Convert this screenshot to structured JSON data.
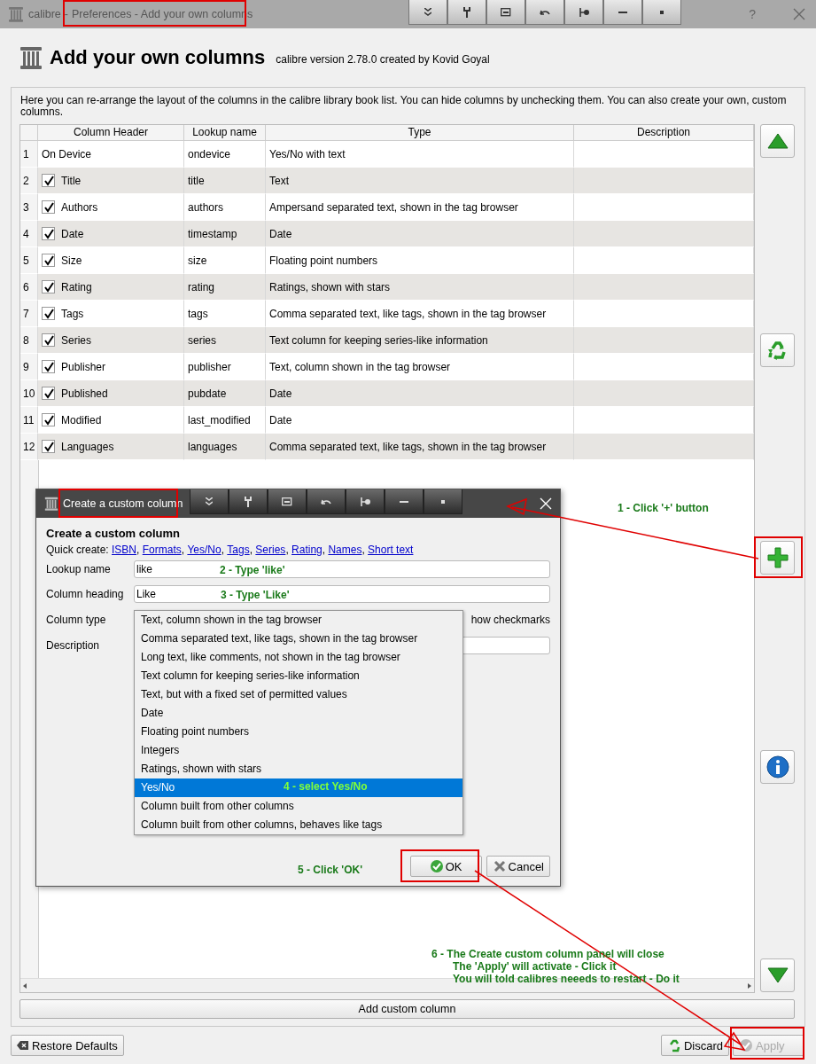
{
  "window": {
    "app": "calibre",
    "separator": "-",
    "title": "Preferences - Add your own columns",
    "help": "?"
  },
  "header": {
    "title": "Add your own columns",
    "subtitle": "calibre version 2.78.0 created by Kovid Goyal"
  },
  "intro": "Here you can re-arrange the layout of the columns in the calibre library book list. You can hide columns by unchecking them. You can also create your own, custom columns.",
  "table": {
    "columns": [
      "Column Header",
      "Lookup name",
      "Type",
      "Description"
    ],
    "rows": [
      {
        "number": "1",
        "kind": "plain",
        "header": "On Device",
        "lookup": "ondevice",
        "type": "Yes/No with text"
      },
      {
        "number": "2",
        "kind": "checkbox",
        "checked": true,
        "header": "Title",
        "lookup": "title",
        "type": "Text"
      },
      {
        "number": "3",
        "kind": "checkbox",
        "checked": true,
        "header": "Authors",
        "lookup": "authors",
        "type": "Ampersand separated text, shown in the tag browser"
      },
      {
        "number": "4",
        "kind": "checkbox",
        "checked": true,
        "header": "Date",
        "lookup": "timestamp",
        "type": "Date"
      },
      {
        "number": "5",
        "kind": "checkbox",
        "checked": true,
        "header": "Size",
        "lookup": "size",
        "type": "Floating point numbers"
      },
      {
        "number": "6",
        "kind": "checkbox",
        "checked": true,
        "header": "Rating",
        "lookup": "rating",
        "type": "Ratings, shown with stars"
      },
      {
        "number": "7",
        "kind": "checkbox",
        "checked": true,
        "header": "Tags",
        "lookup": "tags",
        "type": "Comma separated text, like tags, shown in the tag browser"
      },
      {
        "number": "8",
        "kind": "checkbox",
        "checked": true,
        "header": "Series",
        "lookup": "series",
        "type": "Text column for keeping series-like information"
      },
      {
        "number": "9",
        "kind": "checkbox",
        "checked": true,
        "header": "Publisher",
        "lookup": "publisher",
        "type": "Text, column shown in the tag browser"
      },
      {
        "number": "10",
        "kind": "checkbox",
        "checked": true,
        "header": "Published",
        "lookup": "pubdate",
        "type": "Date"
      },
      {
        "number": "11",
        "kind": "checkbox",
        "checked": true,
        "header": "Modified",
        "lookup": "last_modified",
        "type": "Date"
      },
      {
        "number": "12",
        "kind": "checkbox",
        "checked": true,
        "header": "Languages",
        "lookup": "languages",
        "type": "Comma separated text, like tags, shown in the tag browser"
      }
    ]
  },
  "add_button": "Add custom column",
  "footer": {
    "restore": "Restore Defaults",
    "discard": "Discard",
    "apply": {
      "label": "Apply",
      "disabled": true
    }
  },
  "dialog": {
    "title": "Create a custom column",
    "heading": "Create a custom column",
    "quick_label": "Quick create:",
    "quick_links": [
      "ISBN",
      "Formats",
      "Yes/No",
      "Tags",
      "Series",
      "Rating",
      "Names",
      "Short text"
    ],
    "link_separator": ",",
    "fields": [
      {
        "label": "Lookup name",
        "value": "like"
      },
      {
        "label": "Column heading",
        "value": "Like"
      }
    ],
    "type_label": "Column type",
    "description_label": "Description",
    "checkmarks": "how checkmarks",
    "type_options": [
      {
        "label": "Text, column shown in the tag browser",
        "selected": false
      },
      {
        "label": "Comma separated text, like tags, shown in the tag browser",
        "selected": false
      },
      {
        "label": "Long text, like comments, not shown in the tag browser",
        "selected": false
      },
      {
        "label": "Text column for keeping series-like information",
        "selected": false
      },
      {
        "label": "Text, but with a fixed set of permitted values",
        "selected": false
      },
      {
        "label": "Date",
        "selected": false
      },
      {
        "label": "Floating point numbers",
        "selected": false
      },
      {
        "label": "Integers",
        "selected": false
      },
      {
        "label": "Ratings, shown with stars",
        "selected": false
      },
      {
        "label": "Yes/No",
        "selected": true
      },
      {
        "label": "Column built from other columns",
        "selected": false
      },
      {
        "label": "Column built from other columns, behaves like tags",
        "selected": false
      }
    ],
    "ok": "OK",
    "cancel": "Cancel"
  },
  "annotations": [
    {
      "lines": [
        "1 - Click '+' button"
      ]
    },
    {
      "lines": [
        "2 - Type 'like'"
      ]
    },
    {
      "lines": [
        "3 - Type 'Like'"
      ]
    },
    {
      "lines": [
        "4 - select Yes/No"
      ]
    },
    {
      "lines": [
        "5 - Click 'OK'"
      ]
    },
    {
      "lines": [
        "6 - The Create custom column panel will close",
        "The 'Apply' will activate - Click it",
        "You will told calibres neeeds to restart - Do it"
      ]
    }
  ]
}
